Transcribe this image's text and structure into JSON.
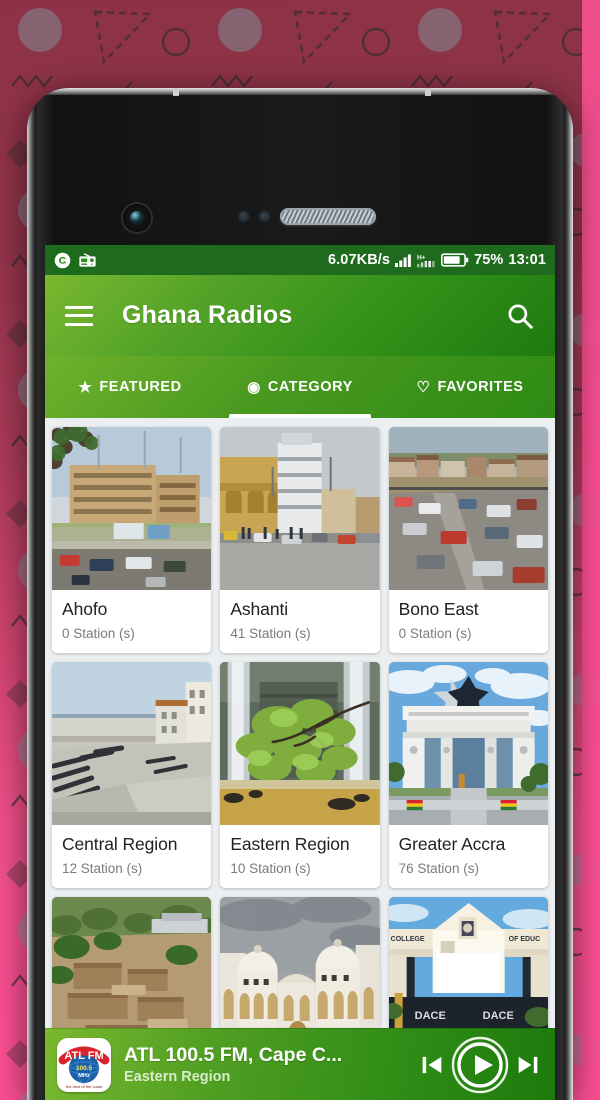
{
  "status_bar": {
    "notification_icons": [
      "app-circle-icon",
      "radio-icon"
    ],
    "network_speed": "6.07KB/s",
    "signal_icon": "signal-bars-icon",
    "network_type": "H+",
    "signal_icon_2": "signal-bars-icon",
    "battery_icon": "battery-icon",
    "battery_percent": "75%",
    "clock": "13:01"
  },
  "app_bar": {
    "menu_icon": "hamburger-menu-icon",
    "title": "Ghana Radios",
    "search_icon": "search-icon"
  },
  "tabs": [
    {
      "label": "FEATURED",
      "icon": "★",
      "icon_name": "star-icon",
      "active": false
    },
    {
      "label": "CATEGORY",
      "icon": "◉",
      "icon_name": "target-circle-icon",
      "active": true
    },
    {
      "label": "FAVORITES",
      "icon": "♡",
      "icon_name": "heart-outline-icon",
      "active": false
    }
  ],
  "categories": [
    {
      "name": "Ahofo",
      "stations": "0 Station (s)",
      "image": "city-street-buildings"
    },
    {
      "name": "Ashanti",
      "stations": "41 Station (s)",
      "image": "kumasi-street-scene"
    },
    {
      "name": "Bono East",
      "stations": "0 Station (s)",
      "image": "busy-road-town"
    },
    {
      "name": "Central Region",
      "stations": "12 Station (s)",
      "image": "cape-coast-castle-cannons"
    },
    {
      "name": "Eastern Region",
      "stations": "10 Station (s)",
      "image": "boti-falls-waterfall"
    },
    {
      "name": "Greater Accra",
      "stations": "76 Station (s)",
      "image": "independence-arch"
    },
    {
      "name": "",
      "stations": "",
      "image": "larabanga-village-ruins"
    },
    {
      "name": "",
      "stations": "",
      "image": "white-domed-palace"
    },
    {
      "name": "",
      "stations": "",
      "image": "college-of-education-gate"
    }
  ],
  "player": {
    "station_logo": "atl-fm-logo",
    "logo_text_top": "ATL FM",
    "logo_text_mid": "100.5 MHz",
    "logo_text_bottom": "the best of the coast",
    "title": "ATL 100.5 FM, Cape C...",
    "subtitle": "Eastern Region",
    "prev_icon": "skip-previous-icon",
    "play_icon": "play-icon",
    "next_icon": "skip-next-icon"
  },
  "colors": {
    "brand_green": "#2f8c16",
    "brand_green_light": "#79b82f",
    "status_bar_green": "#1e6b1e",
    "surface": "#eceff1",
    "card": "#ffffff",
    "title_text": "#212121",
    "muted_text": "#7b7b7b",
    "wallpaper_dark": "#8d3246",
    "wallpaper_pink": "#fd4f93"
  }
}
